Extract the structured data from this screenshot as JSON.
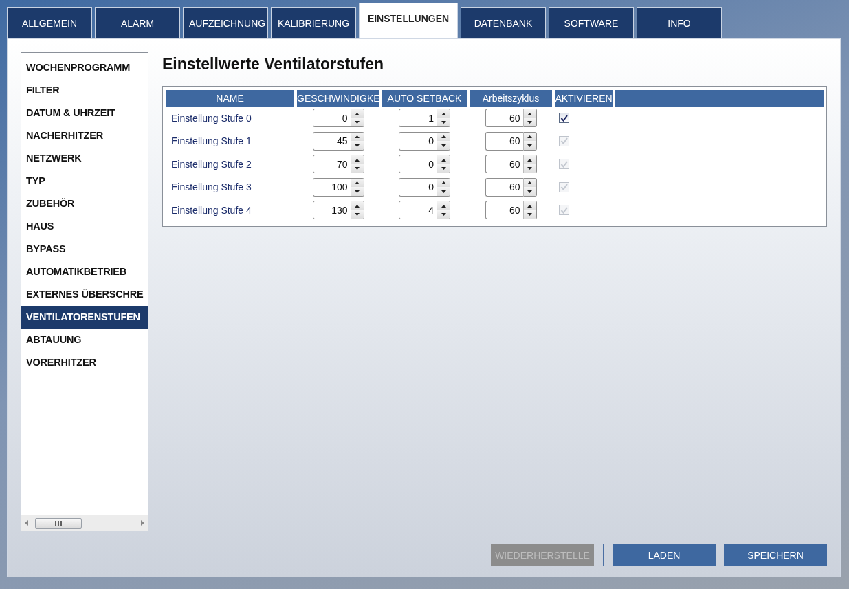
{
  "tabs": [
    {
      "label": "ALLGEMEIN",
      "selected": false
    },
    {
      "label": "ALARM",
      "selected": false
    },
    {
      "label": "AUFZEICHNUNG",
      "selected": false
    },
    {
      "label": "KALIBRIERUNG",
      "selected": false
    },
    {
      "label": "EINSTELLUNGEN",
      "selected": true
    },
    {
      "label": "DATENBANK",
      "selected": false
    },
    {
      "label": "SOFTWARE",
      "selected": false
    },
    {
      "label": "INFO",
      "selected": false
    }
  ],
  "sidebar": {
    "items": [
      {
        "label": "WOCHENPROGRAMM",
        "selected": false
      },
      {
        "label": "FILTER",
        "selected": false
      },
      {
        "label": "DATUM & UHRZEIT",
        "selected": false
      },
      {
        "label": "NACHERHITZER",
        "selected": false
      },
      {
        "label": "NETZWERK",
        "selected": false
      },
      {
        "label": "TYP",
        "selected": false
      },
      {
        "label": "ZUBEHÖR",
        "selected": false
      },
      {
        "label": "HAUS",
        "selected": false
      },
      {
        "label": "BYPASS",
        "selected": false
      },
      {
        "label": "AUTOMATIKBETRIEB",
        "selected": false
      },
      {
        "label": "EXTERNES ÜBERSCHRE",
        "selected": false
      },
      {
        "label": "VENTILATORENSTUFEN",
        "selected": true
      },
      {
        "label": "ABTAUUNG",
        "selected": false
      },
      {
        "label": "VORERHITZER",
        "selected": false
      }
    ]
  },
  "title": "Einstellwerte Ventilatorstufen",
  "table": {
    "columns": [
      "NAME",
      "GESCHWINDIGKE",
      "AUTO SETBACK",
      "Arbeitszyklus",
      "AKTIVIEREN"
    ],
    "rows": [
      {
        "name": "Einstellung Stufe 0",
        "speed": "0",
        "auto_setback": "1",
        "duty_cycle": "60",
        "checked": true,
        "disabled": false
      },
      {
        "name": "Einstellung Stufe 1",
        "speed": "45",
        "auto_setback": "0",
        "duty_cycle": "60",
        "checked": true,
        "disabled": true
      },
      {
        "name": "Einstellung Stufe 2",
        "speed": "70",
        "auto_setback": "0",
        "duty_cycle": "60",
        "checked": true,
        "disabled": true
      },
      {
        "name": "Einstellung Stufe 3",
        "speed": "100",
        "auto_setback": "0",
        "duty_cycle": "60",
        "checked": true,
        "disabled": true
      },
      {
        "name": "Einstellung Stufe 4",
        "speed": "130",
        "auto_setback": "4",
        "duty_cycle": "60",
        "checked": true,
        "disabled": true
      }
    ]
  },
  "buttons": [
    {
      "label": "WIEDERHERSTELLE",
      "disabled": true
    },
    {
      "label": "LADEN",
      "disabled": false
    },
    {
      "label": "SPEICHERN",
      "disabled": false
    }
  ]
}
